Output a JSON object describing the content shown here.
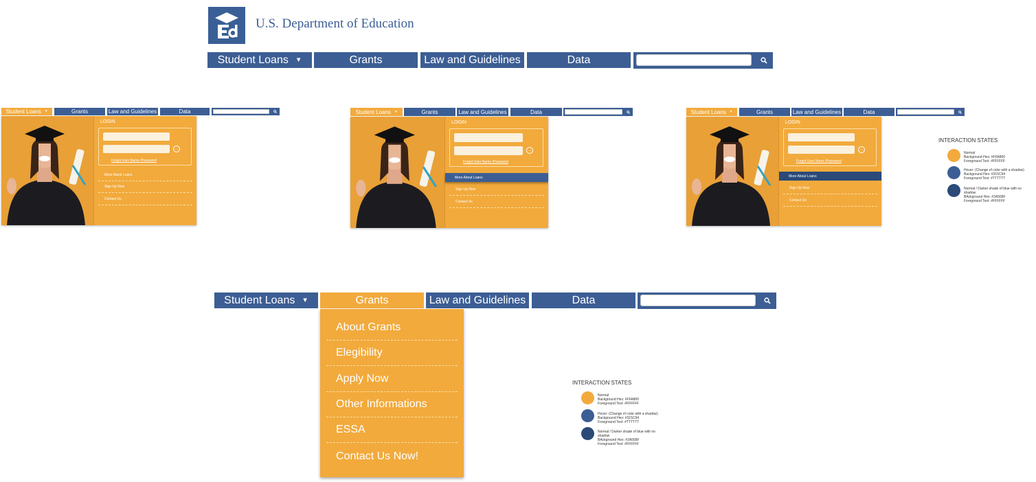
{
  "header": {
    "logo_icon": "ed-logo-icon",
    "agency_name": "U.S. Department of Education"
  },
  "nav": {
    "student_loans": "Student Loans",
    "grants": "Grants",
    "law": "Law and Guidelines",
    "data": "Data",
    "dropdown_icon": "caret-down-icon",
    "search_icon": "magnifier-icon"
  },
  "login_panel": {
    "title": "LOGIN",
    "forgot": "Forgot User Name /Password",
    "submit_icon": "arrow-circle-icon",
    "items": [
      "More About Loans",
      "Sign Up Now",
      "Contact Us"
    ]
  },
  "legend": {
    "title": "INTERACTION STATES",
    "states": [
      {
        "color": "#F2AA3C",
        "lines": [
          "Normal",
          "Background Hex: #FFA800",
          "Foreground Text: #FFFFFF"
        ]
      },
      {
        "color": "#3C5E94",
        "lines": [
          "Hover: (Change of color with a shadow)",
          "Background Hex: #315C94",
          "Foreground Text: #TTTTTT"
        ]
      },
      {
        "color": "#2A4A78",
        "lines": [
          "Normal / Darker shade of blue with no",
          "shadow",
          "BAckground Hex: #2A568F",
          "Foreground Text: #FFFFFF"
        ]
      }
    ]
  },
  "grants_menu": [
    "About Grants",
    "Elegibility",
    "Apply Now",
    "Other Informations",
    "ESSA",
    "Contact Us Now!"
  ],
  "colors": {
    "blue": "#3C5E94",
    "dark_blue": "#2A4A78",
    "orange": "#F2AA3C"
  }
}
